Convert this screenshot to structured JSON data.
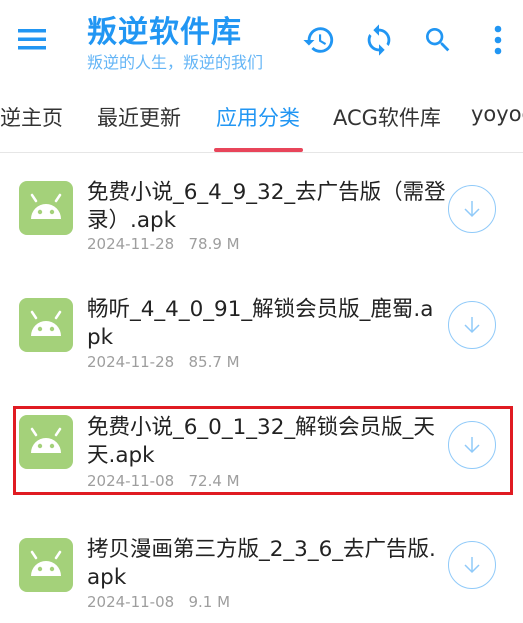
{
  "header": {
    "title": "叛逆软件库",
    "subtitle": "叛逆的人生，叛逆的我们",
    "menu_icon": "menu-icon",
    "history_icon": "history-icon",
    "sync_icon": "sync-icon",
    "search_icon": "search-icon",
    "more_icon": "more-vert-icon",
    "accent_color": "#2196f3"
  },
  "tabs": [
    {
      "label": "逆主页"
    },
    {
      "label": "最近更新"
    },
    {
      "label": "应用分类",
      "active": true
    },
    {
      "label": "ACG软件库"
    },
    {
      "label": "yoyoc"
    }
  ],
  "files": [
    {
      "name": "免费小说_6_4_9_32_去广告版（需登录）.apk",
      "date": "2024-11-28",
      "size": "78.9 M"
    },
    {
      "name": "畅听_4_4_0_91_解锁会员版_鹿蜀.apk",
      "date": "2024-11-28",
      "size": "85.7 M"
    },
    {
      "name": "免费小说_6_0_1_32_解锁会员版_天天.apk",
      "date": "2024-11-08",
      "size": "72.4 M",
      "highlighted": true
    },
    {
      "name": "拷贝漫画第三方版_2_3_6_去广告版.apk",
      "date": "2024-11-08",
      "size": "9.1 M"
    }
  ]
}
